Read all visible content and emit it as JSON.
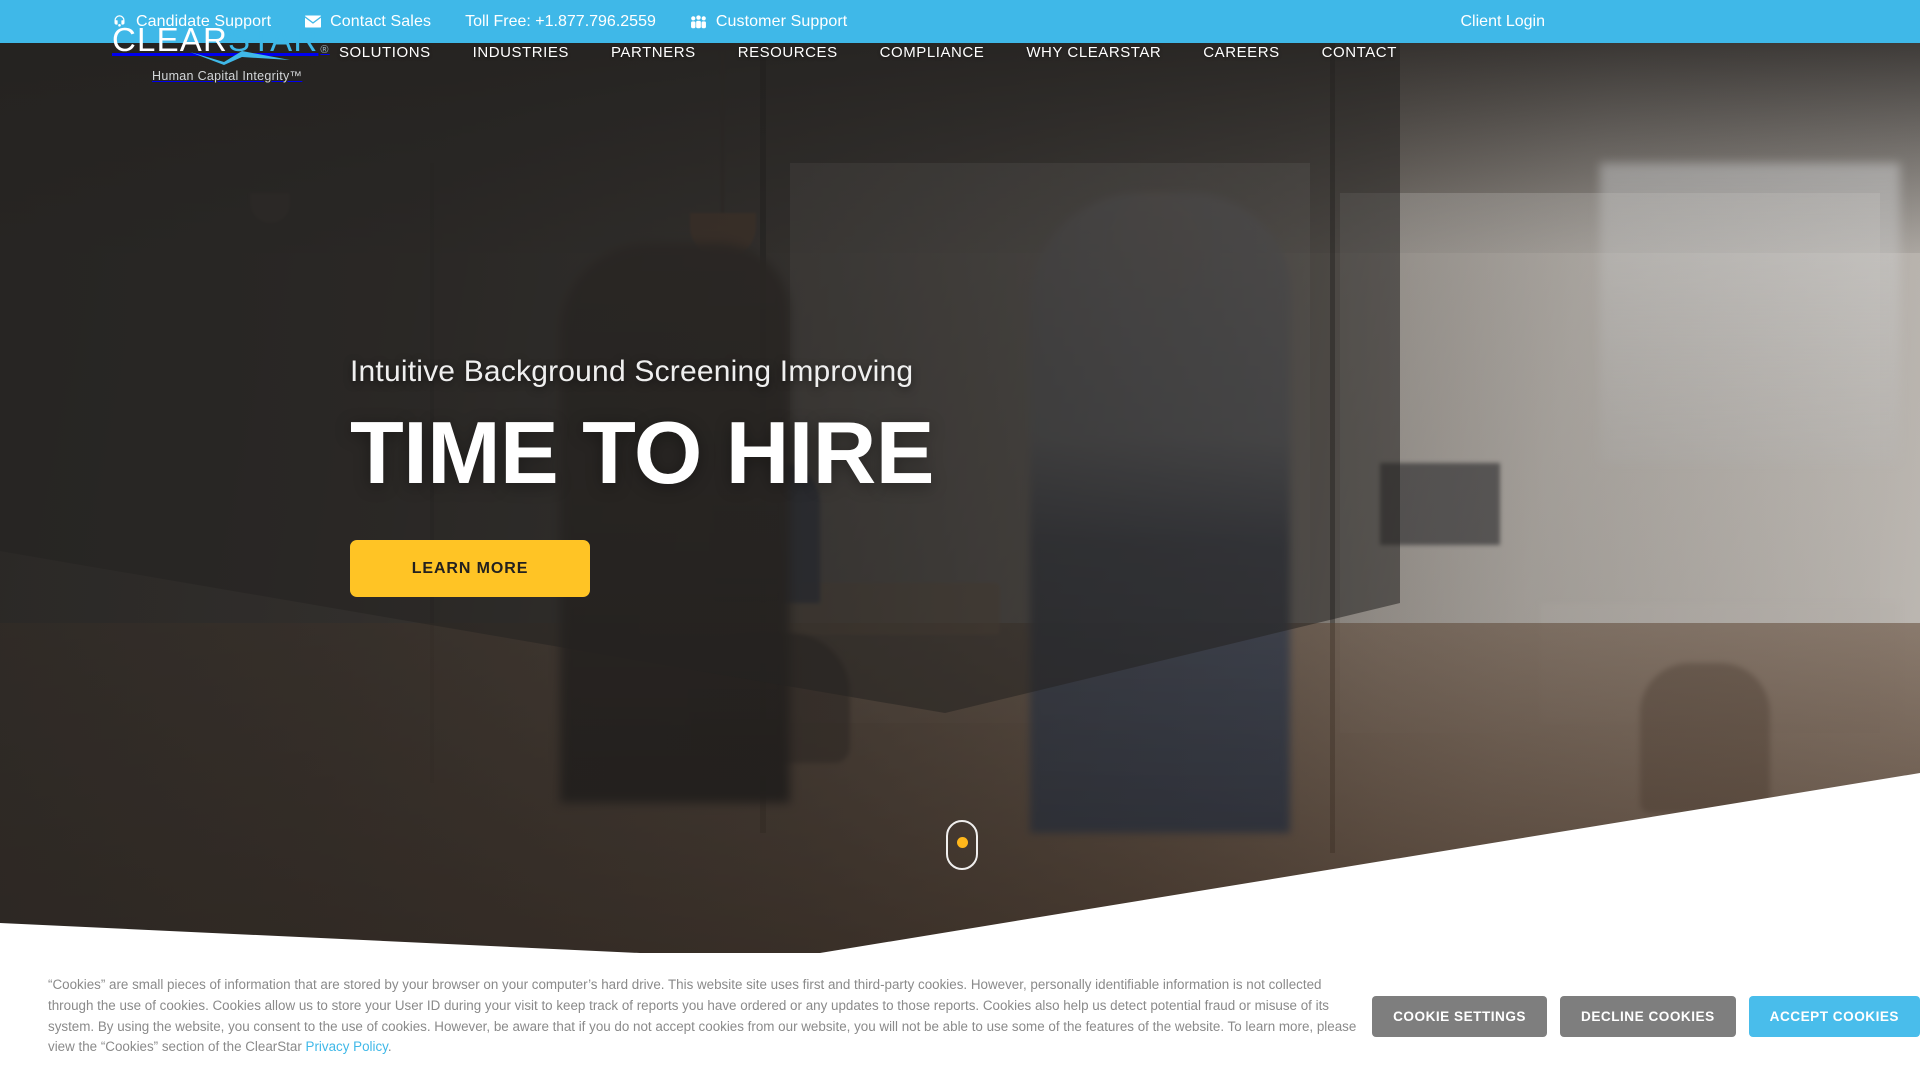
{
  "topbar": {
    "background": "#3FB8E8",
    "links": [
      {
        "icon": "headset-icon",
        "label": "Candidate Support"
      },
      {
        "icon": "envelope-icon",
        "label": "Contact Sales"
      }
    ],
    "toll_free": "Toll Free: +1.877.796.2559",
    "customer_support": {
      "icon": "people-group-icon",
      "label": "Customer Support"
    },
    "client_login": "Client Login"
  },
  "logo": {
    "part1": "CLEAR",
    "part2": "STAR",
    "registered": "®",
    "tagline": "Human Capital Integrity™",
    "color_part1": "#FFFFFF",
    "color_part2": "#3FB8E8"
  },
  "nav": {
    "items": [
      {
        "label": "SOLUTIONS"
      },
      {
        "label": "INDUSTRIES"
      },
      {
        "label": "PARTNERS"
      },
      {
        "label": "RESOURCES"
      },
      {
        "label": "COMPLIANCE"
      },
      {
        "label": "WHY CLEARSTAR"
      },
      {
        "label": "CAREERS"
      },
      {
        "label": "CONTACT"
      }
    ]
  },
  "hero": {
    "eyebrow": "Intuitive Background Screening Improving",
    "headline": "TIME TO HIRE",
    "cta_label": "LEARN MORE",
    "cta_color": "#FFC425",
    "scroll_indicator": "scroll-down-mouse-icon",
    "scroll_dot_color": "#FFB71B"
  },
  "cookie_banner": {
    "line1": "“Cookies” are small pieces of information that are stored by your browser on your computer’s hard drive. This website site uses first and third-party cookies. However, personally identifiable information is not",
    "line2": "collected through the use of cookies. Cookies allow us to store your User ID during your visit to keep track of reports you have ordered or any updates to those reports. Cookies also help us detect potential fraud or",
    "line3": "misuse of its system. By using the website, you consent to the use of cookies. However, be aware that if you do not accept cookies from our website, you will not be able to use some of the features of the website.",
    "line4_prefix": "To learn more, please view the “Cookies” section of the ClearStar ",
    "privacy_link": "Privacy Policy",
    "line4_suffix": ".",
    "buttons": {
      "settings": "COOKIE SETTINGS",
      "decline": "DECLINE COOKIES",
      "accept": "ACCEPT COOKIES"
    },
    "accept_color": "#49BDEB",
    "grey_color": "#7E7E7E",
    "link_color": "#3FB8E8"
  }
}
